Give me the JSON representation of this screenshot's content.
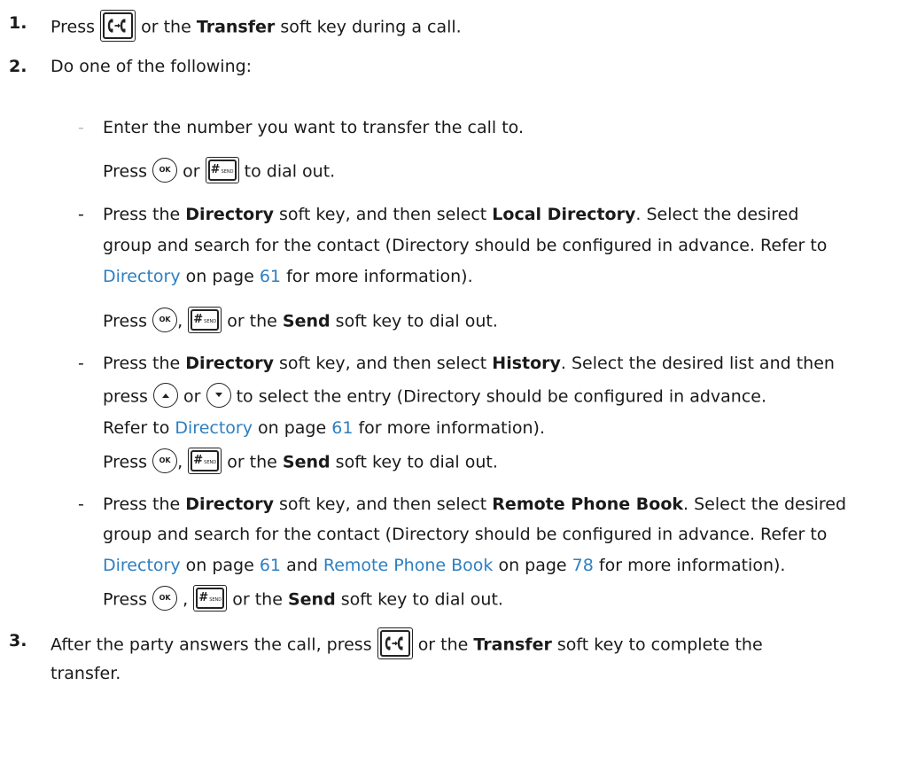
{
  "step1": {
    "number": "1.",
    "press": "Press",
    "or_the": "or the",
    "transfer": "Transfer",
    "rest": "soft key during a call."
  },
  "step2": {
    "number": "2.",
    "text": "Do one of the following:"
  },
  "opt1": {
    "dash": "-",
    "line1": "Enter the number you want to transfer the call to.",
    "press": "Press",
    "or": "or",
    "dial": "to dial out."
  },
  "opt2": {
    "dash": "-",
    "l1_a": "Press the",
    "directory": "Directory",
    "l1_b": "soft key, and then select",
    "local_directory": "Local Directory",
    "l1_c": ". Select the desired",
    "line2": "group and search for the contact (Directory should be configured in advance. Refer to",
    "link_directory": "Directory",
    "on_page": "on page",
    "page_61": "61",
    "line3_rest": "for more information).",
    "press": "Press",
    "comma": ",",
    "or_the": "or the",
    "send": "Send",
    "dial": "soft key to dial out."
  },
  "opt3": {
    "dash": "-",
    "l1_a": "Press the",
    "directory": "Directory",
    "l1_b": "soft key, and then select",
    "history": "History",
    "l1_c": ". Select the desired list and then",
    "press": "press",
    "or": "or",
    "l2_rest": "to select the entry (Directory should be configured in advance.",
    "refer_to": "Refer to",
    "link_directory": "Directory",
    "on_page": "on page",
    "page_61": "61",
    "l3_rest": "for more information).",
    "press2": "Press",
    "comma": ",",
    "or_the": "or the",
    "send": "Send",
    "dial": "soft key to dial out."
  },
  "opt4": {
    "dash": "-",
    "l1_a": "Press the",
    "directory": "Directory",
    "l1_b": "soft key, and then select",
    "remote_phone_book": "Remote Phone Book",
    "l1_c": ". Select the desired",
    "line2": "group and search for the contact (Directory should be configured in advance. Refer to",
    "link_directory": "Directory",
    "on_page": "on page",
    "page_61": "61",
    "and": "and",
    "link_remote": "Remote Phone Book",
    "on_page2": "on page",
    "page_78": "78",
    "l3_rest": "for more information).",
    "press": "Press",
    "comma": ",",
    "or_the": "or the",
    "send": "Send",
    "dial": "soft key to dial out."
  },
  "step3": {
    "number": "3.",
    "l1_a": "After the party answers the call, press",
    "or_the": "or the",
    "transfer": "Transfer",
    "l1_b": "soft key to complete the",
    "line2": "transfer."
  },
  "keys": {
    "ok_label": "OK",
    "send_hash": "#",
    "send_small": "SEND",
    "transfer_icon": "transfer-key-icon",
    "up_icon": "up-arrow-icon",
    "down_icon": "down-arrow-icon"
  },
  "colors": {
    "link": "#2e7fc1",
    "text": "#1a1a1a"
  }
}
